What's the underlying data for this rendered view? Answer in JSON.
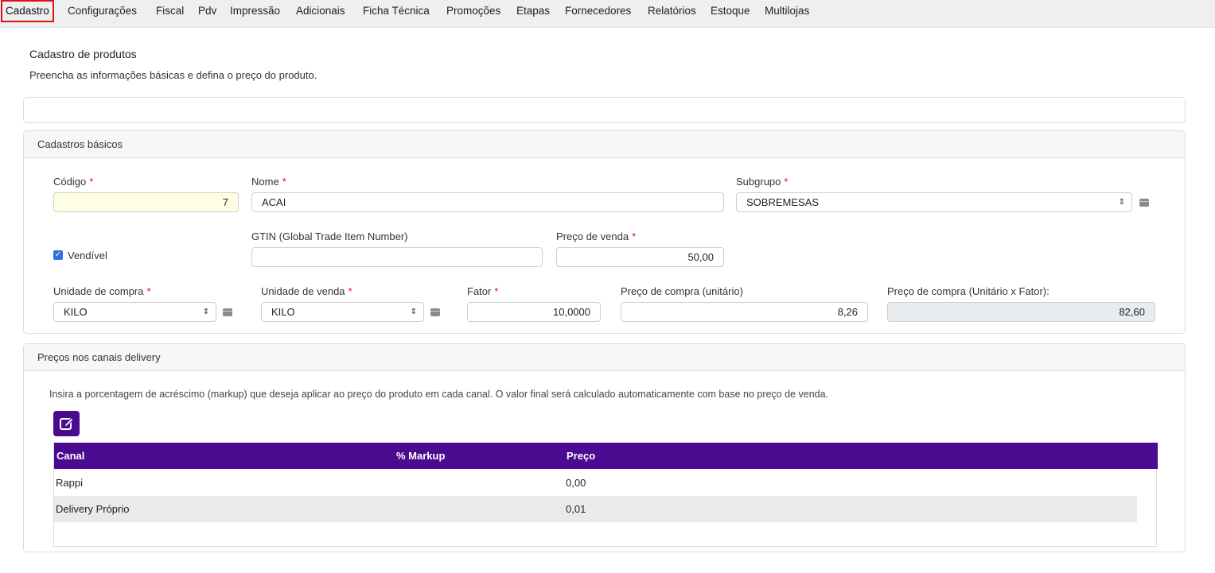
{
  "tabs": [
    {
      "label": "Cadastro",
      "active": true
    },
    {
      "label": "Configurações"
    },
    {
      "label": "Fiscal"
    },
    {
      "label": "Pdv"
    },
    {
      "label": "Impressão"
    },
    {
      "label": "Adicionais"
    },
    {
      "label": "Ficha Técnica"
    },
    {
      "label": "Promoções"
    },
    {
      "label": "Etapas"
    },
    {
      "label": "Fornecedores"
    },
    {
      "label": "Relatórios"
    },
    {
      "label": "Estoque"
    },
    {
      "label": "Multilojas"
    }
  ],
  "page": {
    "title": "Cadastro de produtos",
    "subtitle": "Preencha as informações básicas e defina o preço do produto."
  },
  "basic": {
    "header": "Cadastros básicos",
    "codigo_label": "Código",
    "codigo_value": "7",
    "nome_label": "Nome",
    "nome_value": "ACAI",
    "subgrupo_label": "Subgrupo",
    "subgrupo_value": "SOBREMESAS",
    "vendivel_label": "Vendível",
    "vendivel_checked": true,
    "gtin_label": "GTIN (Global Trade Item Number)",
    "gtin_value": "",
    "preco_venda_label": "Preço de venda",
    "preco_venda_value": "50,00",
    "unidade_compra_label": "Unidade de compra",
    "unidade_compra_value": "KILO",
    "unidade_venda_label": "Unidade de venda",
    "unidade_venda_value": "KILO",
    "fator_label": "Fator",
    "fator_value": "10,0000",
    "preco_compra_label": "Preço de compra (unitário)",
    "preco_compra_value": "8,26",
    "preco_compra_total_label": "Preço de compra (Unitário x Fator):",
    "preco_compra_total_value": "82,60",
    "required_mark": "*"
  },
  "delivery": {
    "header": "Preços nos canais delivery",
    "info": "Insira a porcentagem de acréscimo (markup) que deseja aplicar ao preço do produto em cada canal. O valor final será calculado automaticamente com base no preço de venda.",
    "columns": [
      "Canal",
      "% Markup",
      "Preço"
    ],
    "rows": [
      {
        "canal": "Rappi",
        "markup": "",
        "preco": "0,00"
      },
      {
        "canal": "Delivery Próprio",
        "markup": "",
        "preco": "0,01"
      }
    ]
  },
  "colors": {
    "accent": "#4b0b91",
    "required": "#d9141b",
    "active_tab_border": "#d9141b",
    "checkbox": "#2f6fde"
  },
  "icons": {
    "edit": "edit-icon",
    "select_arrow": "updown-arrow-icon",
    "list_button": "list-icon",
    "checkbox": "checkmark-icon"
  }
}
